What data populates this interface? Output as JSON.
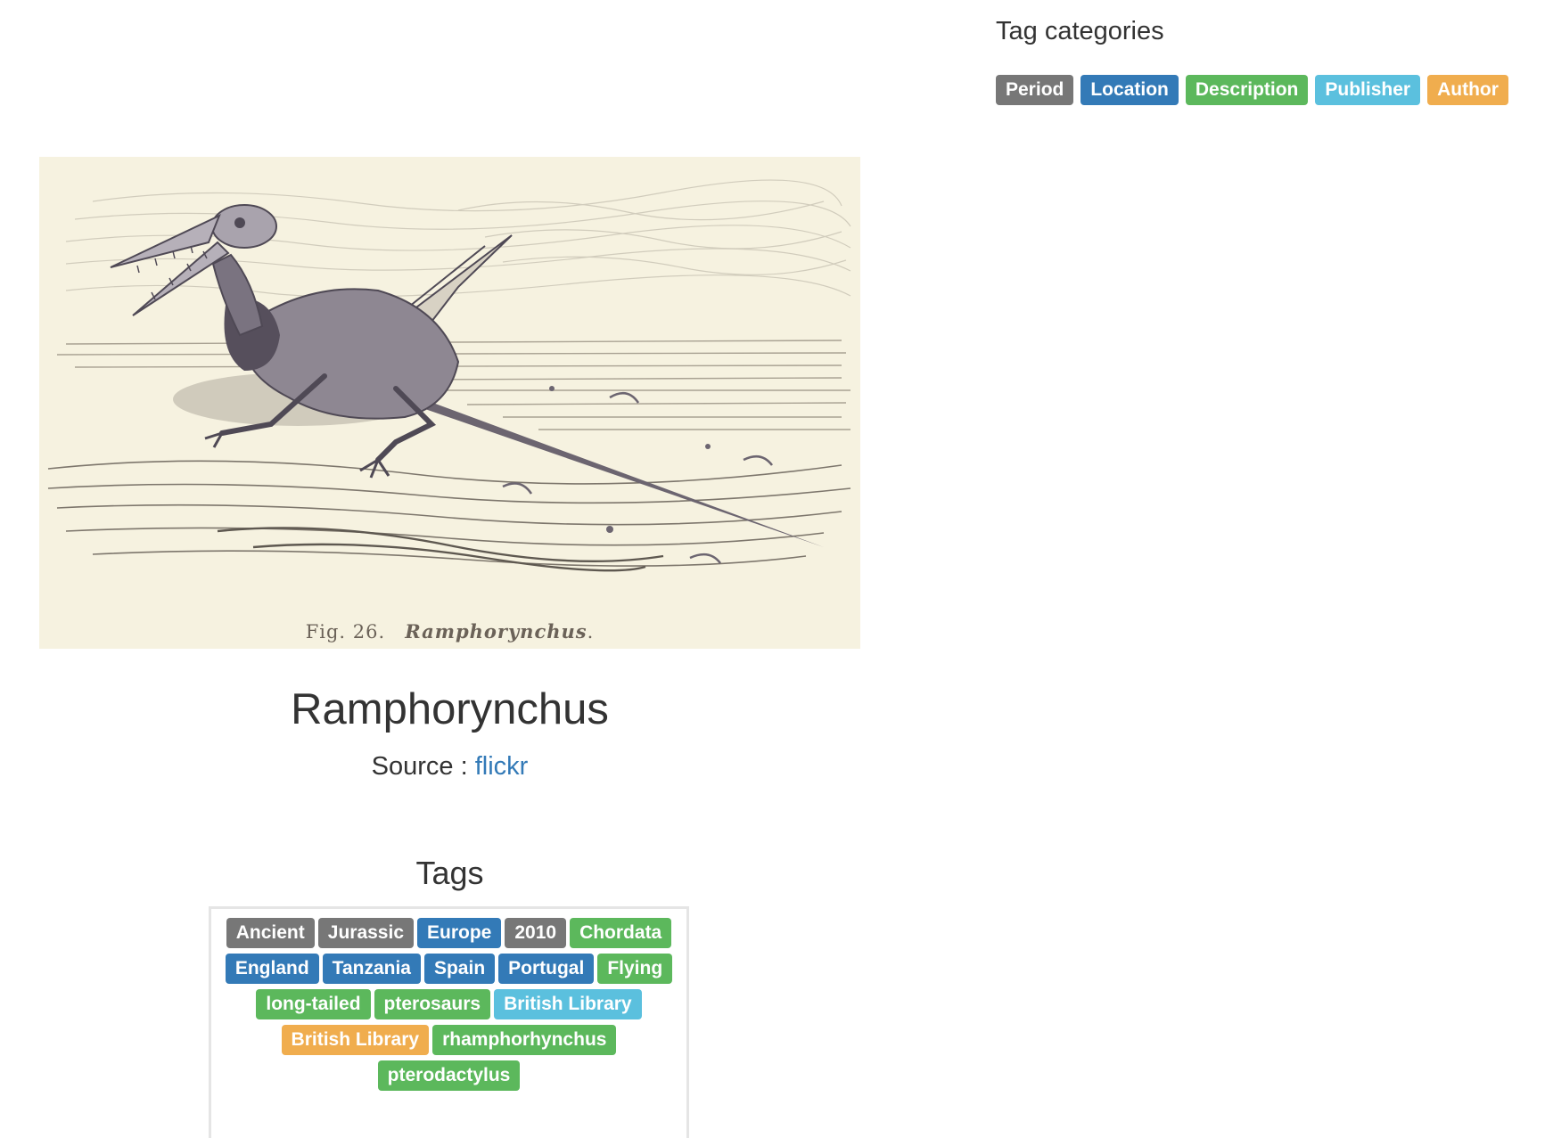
{
  "tag_categories": {
    "heading": "Tag categories",
    "items": [
      {
        "label": "Period",
        "type": "period"
      },
      {
        "label": "Location",
        "type": "location"
      },
      {
        "label": "Description",
        "type": "description"
      },
      {
        "label": "Publisher",
        "type": "publisher"
      },
      {
        "label": "Author",
        "type": "author"
      }
    ]
  },
  "image": {
    "caption_fig": "Fig. 26.",
    "caption_name": "Ramphorynchus"
  },
  "title": "Ramphorynchus",
  "source": {
    "prefix": "Source : ",
    "link_text": "flickr"
  },
  "tags": {
    "heading": "Tags",
    "items": [
      {
        "label": "Ancient",
        "type": "period"
      },
      {
        "label": "Jurassic",
        "type": "period"
      },
      {
        "label": "Europe",
        "type": "location"
      },
      {
        "label": "2010",
        "type": "period"
      },
      {
        "label": "Chordata",
        "type": "description"
      },
      {
        "label": "England",
        "type": "location"
      },
      {
        "label": "Tanzania",
        "type": "location"
      },
      {
        "label": "Spain",
        "type": "location"
      },
      {
        "label": "Portugal",
        "type": "location"
      },
      {
        "label": "Flying",
        "type": "description"
      },
      {
        "label": "long-tailed",
        "type": "description"
      },
      {
        "label": "pterosaurs",
        "type": "description"
      },
      {
        "label": "British Library",
        "type": "publisher"
      },
      {
        "label": "British Library",
        "type": "author"
      },
      {
        "label": "rhamphorhynchus",
        "type": "description"
      },
      {
        "label": "pterodactylus",
        "type": "description"
      }
    ]
  },
  "colors": {
    "period": "#777777",
    "location": "#337ab7",
    "description": "#5cb85c",
    "publisher": "#5bc0de",
    "author": "#f0ad4e",
    "link": "#337ab7"
  }
}
